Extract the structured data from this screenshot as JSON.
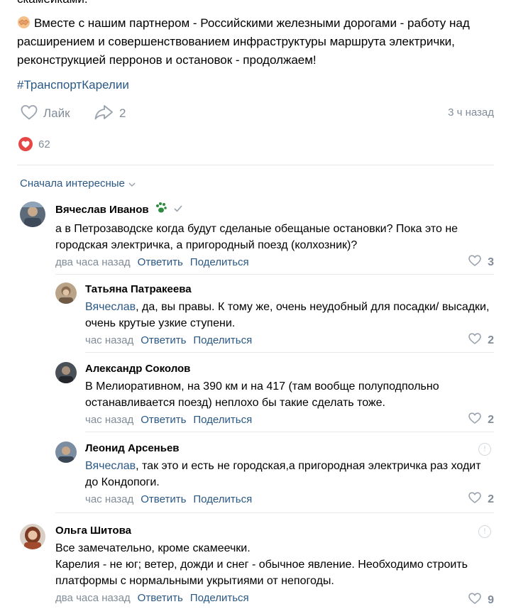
{
  "post": {
    "cut_line": "скамейками.",
    "text": "Вместе с нашим партнером - Российскими железными дорогами - работу над расширением и совершенствованием инфраструктуры маршрута электрички, реконструкцией перронов и остановок - продолжаем!",
    "hashtag": "#ТранспортКарелии",
    "like_label": "Лайк",
    "share_count": "2",
    "time": "3 ч назад",
    "reactions_count": "62"
  },
  "comments_sort": "Сначала интересные",
  "comments": [
    {
      "author": "Вячеслав Иванов",
      "text": "а в Петрозаводске когда будут сделаные обещаные остановки? Пока это не городская электричка, а пригородный поезд (колхозник)?",
      "time": "два часа назад",
      "reply": "Ответить",
      "share": "Поделиться",
      "likes": "3"
    },
    {
      "author": "Татьяна Патракеева",
      "mention": "Вячеслав",
      "text": ", да, вы правы. К тому же, очень неудобный для посадки/ высадки, очень крутые узкие ступени.",
      "time": "час назад",
      "reply": "Ответить",
      "share": "Поделиться",
      "likes": "2"
    },
    {
      "author": "Александр Соколов",
      "text": "В Мелиоративном, на 390 км и на 417 (там вообще полуподпольно останавливается поезд) неплохо бы такие сделать тоже.",
      "time": "час назад",
      "reply": "Ответить",
      "share": "Поделиться",
      "likes": "2"
    },
    {
      "author": "Леонид Арсеньев",
      "mention": "Вячеслав",
      "text": ", так это и есть не городская,а пригородная электричка раз ходит до Кондопоги.",
      "time": "час назад",
      "reply": "Ответить",
      "share": "Поделиться",
      "likes": "2"
    },
    {
      "author": "Ольга Шитова",
      "text_line1": "Все замечательно, кроме скамеечки.",
      "text_line2": "Карелия - не юг; ветер, дожди и снег - обычное явление. Необходимо строить платформы с нормальными укрытиями от непогоды.",
      "time": "два часа назад",
      "reply": "Ответить",
      "share": "Поделиться",
      "likes": "9"
    }
  ],
  "colors": {
    "link": "#2a5885",
    "muted": "#818c99",
    "heart": "#e64646",
    "divider": "#e7e8ec"
  }
}
